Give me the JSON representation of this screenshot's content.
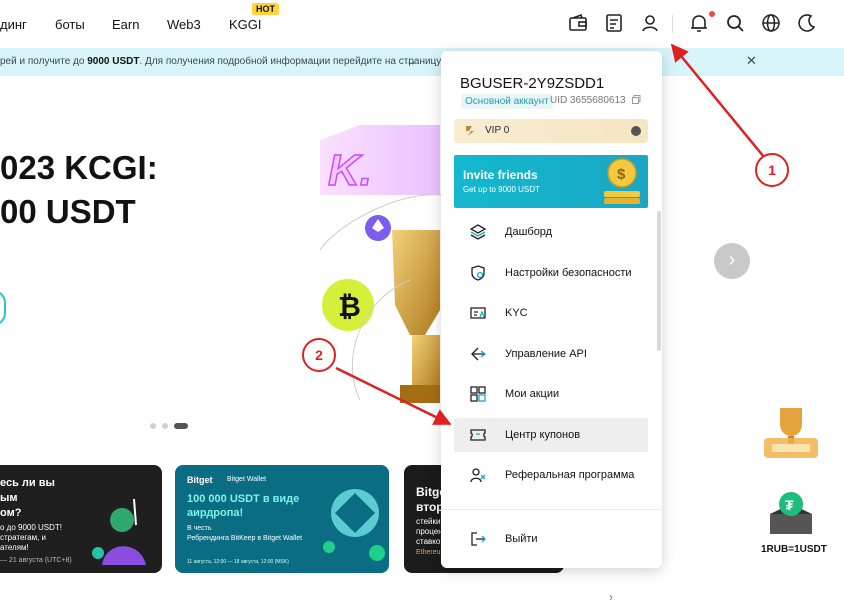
{
  "nav": {
    "items": [
      "динг",
      "боты",
      "Earn",
      "Web3",
      "KGGI"
    ],
    "hot_badge": "HOT",
    "icons": [
      "wallet-icon",
      "orders-icon",
      "user-icon",
      "bell-icon",
      "search-icon",
      "globe-icon",
      "moon-icon"
    ]
  },
  "banner": {
    "text_pre": "рей и получите до ",
    "text_bold": "9000 USDT",
    "text_post": ". Для получения подробной информации перейдите на страницу активности.",
    "arrow": "→",
    "close": "✕"
  },
  "hero": {
    "title_line1": "023 KCGI:",
    "title_line2": "00 USDT",
    "next": "›"
  },
  "cards": {
    "c1_l1": "есь ли вы",
    "c1_l2": "ым",
    "c1_l3": "ом?",
    "c1_l4": "о до 9000 USDT!",
    "c1_l5": "стратегам, и",
    "c1_l6": "ателям!",
    "c1_l7": "— 21 августа (UTC+8)",
    "c2_brand1": "Bitget",
    "c2_brand2": "Bitget Wallet",
    "c2_title1": "100 000 USDT в виде",
    "c2_title2": "аирдропа!",
    "c2_sub1": "В честь",
    "c2_sub2": "Ребрендинга BitKeep в Bitget Wallet",
    "c2_foot": "11 августа, 12:00 — 18 августа, 12:00 (MSK)",
    "c3_l1": "Bitge",
    "c3_l2": "втор",
    "c3_l3": "стейки",
    "c3_l4": "процен",
    "c3_l5": "ставко",
    "c3_l6": "Ethereum"
  },
  "panel": {
    "username": "BGUSER-2Y9ZSDD1",
    "account_badge": "Основной аккаунт",
    "uid": "UID 3655680613",
    "vip": "VIP 0",
    "invite_title": "Invite friends",
    "invite_sub": "Get up to 9000 USDT",
    "menu": [
      {
        "label": "Дашборд",
        "icon": "layers-icon"
      },
      {
        "label": "Настройки безопасности",
        "icon": "shield-icon"
      },
      {
        "label": "KYC",
        "icon": "id-card-icon"
      },
      {
        "label": "Управление API",
        "icon": "api-icon"
      },
      {
        "label": "Мои акции",
        "icon": "grid-icon"
      },
      {
        "label": "Центр купонов",
        "icon": "coupon-icon"
      },
      {
        "label": "Реферальная программа",
        "icon": "referral-icon"
      }
    ],
    "logout": "Выйти"
  },
  "side": {
    "widget2_label": "1RUB=1USDT"
  },
  "annotations": {
    "one": "1",
    "two": "2",
    "color": "#e02020"
  },
  "colors": {
    "accent": "#1aa7c6",
    "banner_bg": "#d7f4f8",
    "hot": "#ffd43b"
  }
}
